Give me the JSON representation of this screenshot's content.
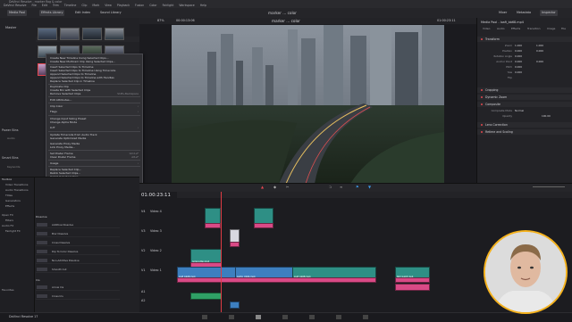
{
  "titlebar": {
    "title": "DaVinci Resolve - marker flag & color"
  },
  "menu": [
    "DaVinci Resolve",
    "File",
    "Edit",
    "Trim",
    "Timeline",
    "Clip",
    "Mark",
    "View",
    "Playback",
    "Fusion",
    "Color",
    "Fairlight",
    "Workspace",
    "Help"
  ],
  "toolbar": {
    "media_pool": "Media Pool",
    "effects_library": "Effects Library",
    "edit_index": "Edit Index",
    "sound_library": "Sound Library",
    "project_name": "marker ... color",
    "mixer": "Mixer",
    "metadata": "Metadata",
    "inspector": "Inspector"
  },
  "media_pool": {
    "master": "Master",
    "power_bins": "Power Bins",
    "power_bin_item": "Audio",
    "smart_bins": "Smart Bins",
    "smart_bin_item": "Keywords"
  },
  "viewer": {
    "zoom": "87%",
    "source_tc": "00:00:13:06",
    "clip_name": "marker ... color",
    "timeline_name": "Timeline 1",
    "record_tc": "01:00:23:11"
  },
  "context_menu": {
    "items": [
      "Create New Timeline Using Selected Clips...",
      "Create New Multicam Clip Using Selected Clips...",
      "Insert Selected Clips to Timeline",
      "Insert Selected Clips to Timeline Using Timecode",
      "Append Selected Clips to Timeline",
      "Append Selected Clips to Timeline with Handles",
      "Replace Selected Clip in Timeline",
      "Duplicate Clip",
      "Create Bin with Selected Clips",
      "Remove Selected Clips",
      "Edit Attributes...",
      "Clip Color",
      "Flags",
      "Change Input Sizing Preset",
      "Change Alpha Mode",
      "LUT",
      "Update Timecode from Audio Track",
      "Generate Optimized Media",
      "Generate Proxy Media",
      "Link Proxy Media...",
      "Set Poster Frame",
      "Clear Poster Frame",
      "Usage",
      "Replace Selected Clip...",
      "Relink Selected Clips...",
      "Unlink Selected Clips",
      "Reveal in Media Storage",
      "Reveal in Finder",
      "Open File Location"
    ],
    "shortcuts": [
      "Backspace",
      "Shift+Backspace"
    ],
    "shortcut2": [
      "Cmd+F",
      "Alt+F"
    ]
  },
  "inspector": {
    "title": "Media Pool - loafi_bb68.mp4",
    "tabs": [
      "Video",
      "Audio",
      "Effects",
      "Transition",
      "Image",
      "File"
    ],
    "transform": "Transform",
    "zoom_label": "Zoom",
    "zoom_x": "1.000",
    "zoom_y": "1.000",
    "position_label": "Position",
    "position_x": "0.000",
    "position_y": "0.000",
    "rotation_label": "Rotation Angle",
    "rotation": "0.000",
    "anchor_label": "Anchor Point",
    "anchor_x": "0.000",
    "anchor_y": "0.000",
    "pitch_label": "Pitch",
    "pitch": "0.000",
    "yaw_label": "Yaw",
    "yaw": "0.000",
    "flip_label": "Flip",
    "cropping": "Cropping",
    "dynamic_zoom": "Dynamic Zoom",
    "composite": "Composite",
    "composite_mode_label": "Composite Mode",
    "composite_mode": "Normal",
    "opacity_label": "Opacity",
    "opacity": "100.00",
    "lens_correction": "Lens Correction",
    "retime": "Retime and Scaling"
  },
  "timeline": {
    "timecode": "01:00:23:11",
    "tracks": [
      {
        "id": "V4",
        "name": "Video 4"
      },
      {
        "id": "V3",
        "name": "Video 3"
      },
      {
        "id": "V2",
        "name": "Video 2"
      },
      {
        "id": "V1",
        "name": "Video 1"
      },
      {
        "id": "A1",
        "name": "A1"
      },
      {
        "id": "A2",
        "name": "A2"
      }
    ],
    "clips": {
      "v2_clip": "Jumpcutter.mp4",
      "v1_clip_1": "loafi_bb68.mp4",
      "v1_clip_2": "GoPro_0024.mp4",
      "v1_clip_3": "loafi_bb68.mp4",
      "right_clip": "Still_bulk5.mp4"
    }
  },
  "effects": {
    "toolbox": "Toolbox",
    "nav": [
      "Video Transitions",
      "Audio Transitions",
      "Titles",
      "Generators",
      "Effects",
      "Open FX",
      "Filters",
      "Audio FX",
      "Fairlight FX"
    ],
    "section_header": "Dissolve",
    "items": [
      "Additive Dissolve",
      "Blur Dissolve",
      "Cross Dissolve",
      "Dip To Color Dissolve",
      "Non-Additive Dissolve",
      "Smooth Cut"
    ],
    "iris_header": "Iris",
    "iris_items": [
      "Arrow Iris",
      "Cross Iris"
    ],
    "favorites": "Favorites"
  },
  "statusbar": {
    "title": "DaVinci Resolve 17"
  },
  "colors": {
    "accent_red": "#e5474f",
    "clip_teal": "#2e8f85",
    "clip_pink": "#d94a86",
    "clip_blue": "#3d7fbf",
    "webcam_ring": "#f5b21d"
  }
}
